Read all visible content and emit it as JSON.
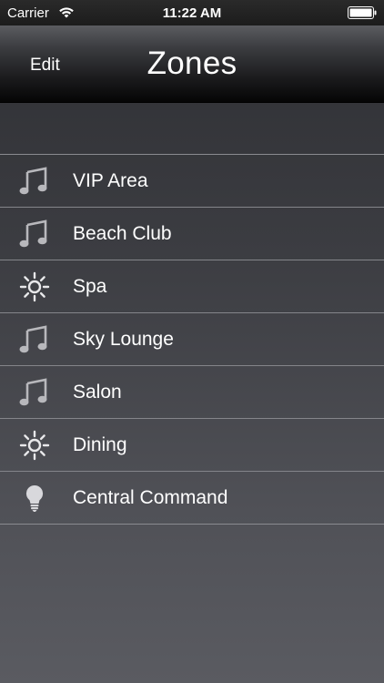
{
  "status_bar": {
    "carrier": "Carrier",
    "time": "11:22 AM",
    "wifi_icon": "wifi-icon",
    "battery_icon": "battery-icon"
  },
  "nav": {
    "edit_label": "Edit",
    "title": "Zones"
  },
  "zones": [
    {
      "label": "VIP Area",
      "icon": "music-note-icon"
    },
    {
      "label": "Beach Club",
      "icon": "music-note-icon"
    },
    {
      "label": "Spa",
      "icon": "sun-icon"
    },
    {
      "label": "Sky Lounge",
      "icon": "music-note-icon"
    },
    {
      "label": "Salon",
      "icon": "music-note-icon"
    },
    {
      "label": "Dining",
      "icon": "sun-icon"
    },
    {
      "label": "Central Command",
      "icon": "lightbulb-icon"
    }
  ],
  "colors": {
    "nav_bar": "#1a1a1c",
    "list_background": "#3b3c41",
    "separator": "#84858a",
    "text": "#ffffff",
    "icon_gray": "#b8b8bc"
  }
}
